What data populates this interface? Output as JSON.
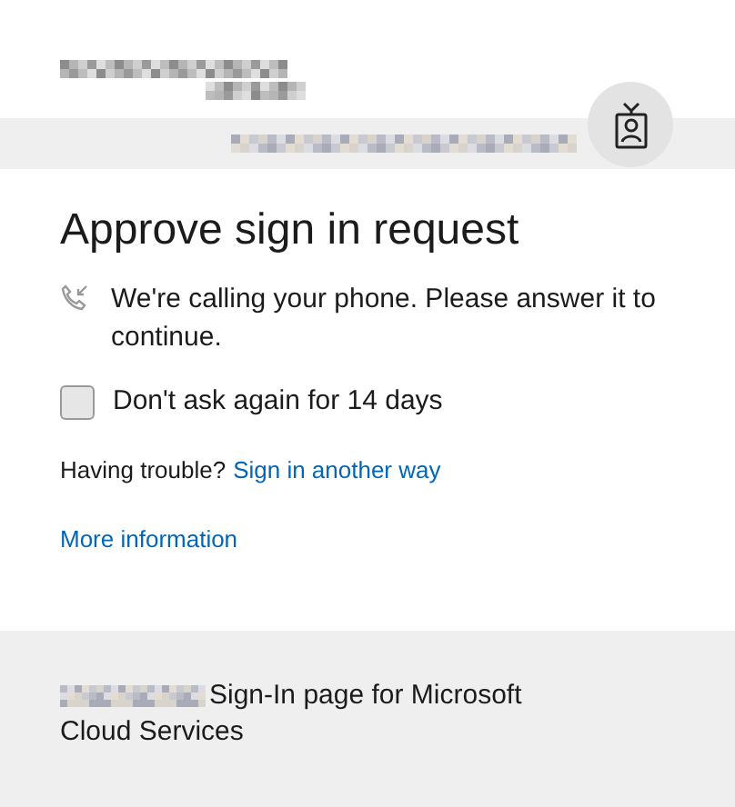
{
  "header": {
    "logo": {
      "kind": "redacted"
    },
    "account": {
      "kind": "redacted"
    }
  },
  "title": "Approve sign in request",
  "message": "We're calling your phone. Please answer it to continue.",
  "remember": {
    "label": "Don't ask again for 14 days",
    "checked": false
  },
  "trouble": {
    "text": "Having trouble?",
    "link": "Sign in another way"
  },
  "more_info": "More information",
  "footer": {
    "lines": [
      "Sign-In page for Microsoft",
      "Cloud Services"
    ]
  }
}
